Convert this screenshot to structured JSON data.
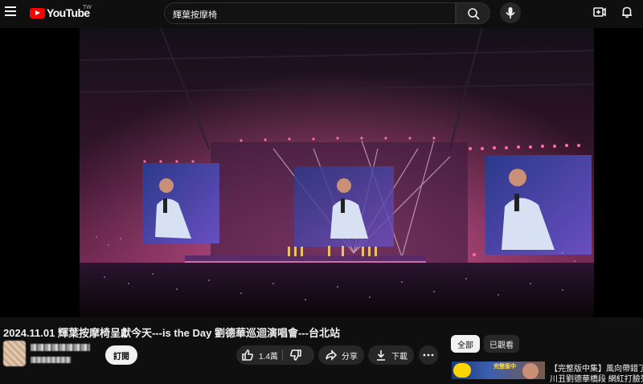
{
  "header": {
    "logo_text": "YouTube",
    "logo_country": "TW",
    "search_value": "輝葉按摩椅"
  },
  "video": {
    "title": "2024.11.01 輝葉按摩椅呈獻今天---is the Day 劉德華巡迴演唱會---台北站"
  },
  "actions": {
    "subscribe_label": "訂閱",
    "like_count": "1.4萬",
    "share_label": "分享",
    "download_label": "下載"
  },
  "filters": {
    "chips": [
      "全部",
      "已觀看"
    ]
  },
  "recommendations": [
    {
      "title": "【完整版中集】風向帶錯了!",
      "subtitle": "川丑劉德華橋段 網紅打臉列",
      "thumb_text": "完整版中"
    }
  ],
  "colors": {
    "accent_red": "#ff0000",
    "background": "#0f0f0f",
    "pill": "#272727",
    "stage_pink": "#ff3d8a"
  }
}
